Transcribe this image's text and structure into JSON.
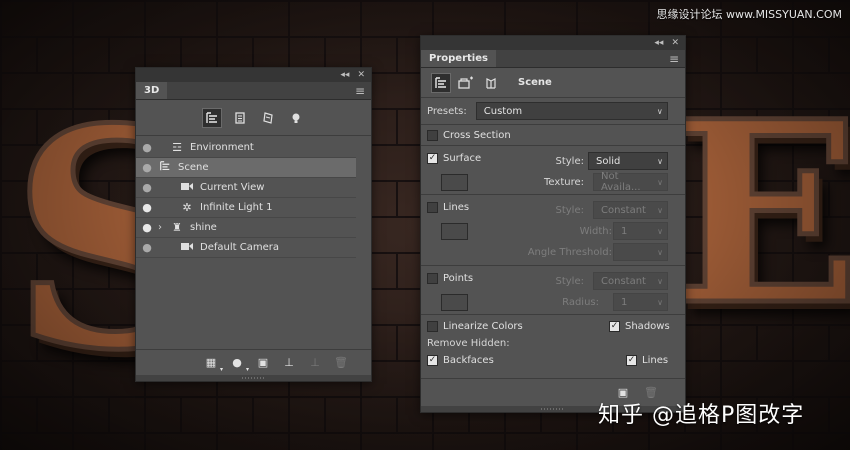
{
  "watermark_top": "思缘设计论坛 www.MISSYUAN.COM",
  "watermark_bottom": "知乎 @追格P图改字",
  "artwork": {
    "left_letter": "S",
    "right_letter": "E"
  },
  "panel_controls": {
    "collapse": "◂◂",
    "close": "✕",
    "menu": "≡"
  },
  "panel_3d": {
    "tab_label": "3D",
    "layers": [
      {
        "name": "Environment",
        "eye": "visible-dim",
        "icon": "environment-icon"
      },
      {
        "name": "Scene",
        "eye": "visible-dim",
        "icon": "scene-icon",
        "selected": true
      },
      {
        "name": "Current View",
        "eye": "visible-dim",
        "icon": "camera-icon"
      },
      {
        "name": "Infinite Light 1",
        "eye": "visible",
        "icon": "infinite-light-icon"
      },
      {
        "name": "shine",
        "eye": "visible",
        "icon": "mesh-icon",
        "expandable": true
      },
      {
        "name": "Default Camera",
        "eye": "visible-dim",
        "icon": "camera-icon"
      }
    ]
  },
  "panel_props": {
    "tab_label": "Properties",
    "title": "Scene",
    "presets_label": "Presets:",
    "presets_value": "Custom",
    "cross_section": {
      "label": "Cross Section",
      "checked": false
    },
    "surface": {
      "label": "Surface",
      "checked": true,
      "style_label": "Style:",
      "style_value": "Solid",
      "texture_label": "Texture:",
      "texture_value": "Not Availa..."
    },
    "lines": {
      "label": "Lines",
      "checked": false,
      "style_label": "Style:",
      "style_value": "Constant",
      "width_label": "Width:",
      "width_value": "1",
      "angle_label": "Angle Threshold:",
      "angle_value": ""
    },
    "points": {
      "label": "Points",
      "checked": false,
      "style_label": "Style:",
      "style_value": "Constant",
      "radius_label": "Radius:",
      "radius_value": "1"
    },
    "linearize_colors": {
      "label": "Linearize Colors",
      "checked": false
    },
    "shadows": {
      "label": "Shadows",
      "checked": true
    },
    "remove_hidden_label": "Remove Hidden:",
    "backfaces": {
      "label": "Backfaces",
      "checked": true
    },
    "lines_hidden": {
      "label": "Lines",
      "checked": true
    }
  }
}
